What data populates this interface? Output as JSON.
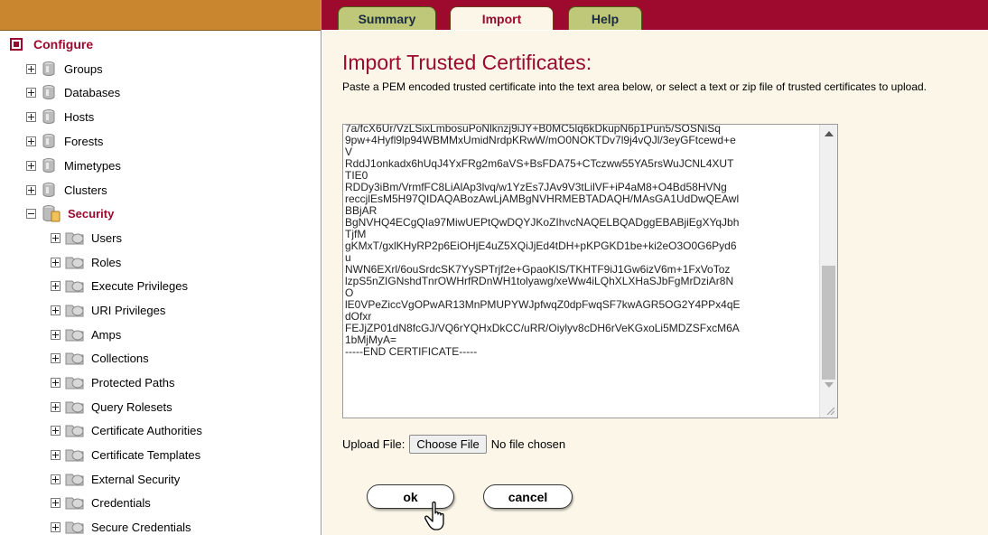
{
  "tabs": [
    "Summary",
    "Import",
    "Help"
  ],
  "sidebar": {
    "root_label": "Configure",
    "items": [
      {
        "label": "Groups"
      },
      {
        "label": "Databases"
      },
      {
        "label": "Hosts"
      },
      {
        "label": "Forests"
      },
      {
        "label": "Mimetypes"
      },
      {
        "label": "Clusters"
      }
    ],
    "security_label": "Security",
    "security_items": [
      {
        "label": "Users"
      },
      {
        "label": "Roles"
      },
      {
        "label": "Execute Privileges"
      },
      {
        "label": "URI Privileges"
      },
      {
        "label": "Amps"
      },
      {
        "label": "Collections"
      },
      {
        "label": "Protected Paths"
      },
      {
        "label": "Query Rolesets"
      },
      {
        "label": "Certificate Authorities"
      },
      {
        "label": "Certificate Templates"
      },
      {
        "label": "External Security"
      },
      {
        "label": "Credentials"
      },
      {
        "label": "Secure Credentials"
      }
    ]
  },
  "main": {
    "title": "Import Trusted Certificates:",
    "instructions": "Paste a PEM encoded trusted certificate into the text area below, or select a text or zip file of trusted certificates to upload.",
    "certificate_lines": [
      "7a/fcX6Ur/VzLSixLmbosuPoNlknzj9iJY+B0MC5lq6kDkupN6p1Pun5/SOSNiSq",
      "9pw+4Hyfl9lp94WBMMxUmidNrdpKRwW/mO0NOKTDv7l9j4vQJl/3eyGFtcewd+e",
      "V",
      "RddJ1onkadx6hUqJ4YxFRg2m6aVS+BsFDA75+CTczww55YA5rsWuJCNL4XUT",
      "TIE0",
      "RDDy3iBm/VrmfFC8LiAlAp3lvq/w1YzEs7JAv9V3tLilVF+iP4aM8+O4Bd58HVNg",
      "reccjlEsM5H97QIDAQABozAwLjAMBgNVHRMEBTADAQH/MAsGA1UdDwQEAwl",
      "BBjAR",
      "BgNVHQ4ECgQIa97MiwUEPtQwDQYJKoZIhvcNAQELBQADggEBABjiEgXYqJbh",
      "TjfM",
      "gKMxT/gxlKHyRP2p6EiOHjE4uZ5XQiJjEd4tDH+pKPGKD1be+ki2eO3O0G6Pyd6",
      "u",
      "NWN6EXrl/6ouSrdcSK7YySPTrjf2e+GpaoKIS/TKHTF9iJ1Gw6izV6m+1FxVoToz",
      "lzpS5nZIGNshdTnrOWHrfRDnWH1tolyawg/xeWw4iLQhXLXHaSJbFgMrDziAr8N",
      "O",
      "lE0VPeZiccVgOPwAR13MnPMUPYWJpfwqZ0dpFwqSF7kwAGR5OG2Y4PPx4qE",
      "dOfxr",
      "FEJjZP01dN8fcGJ/VQ6rYQHxDkCC/uRR/Oiylyv8cDH6rVeKGxoLi5MDZSFxcM6A",
      "1bMjMyA=",
      "-----END CERTIFICATE-----"
    ],
    "upload_label": "Upload File:",
    "choose_button": "Choose File",
    "no_file_text": "No file chosen",
    "ok_label": "ok",
    "cancel_label": "cancel"
  },
  "colors": {
    "accent": "#9a0a2e",
    "topbar_left": "#c9862e",
    "tab_green": "#bfc879",
    "content_bg": "#fbf6e8"
  }
}
